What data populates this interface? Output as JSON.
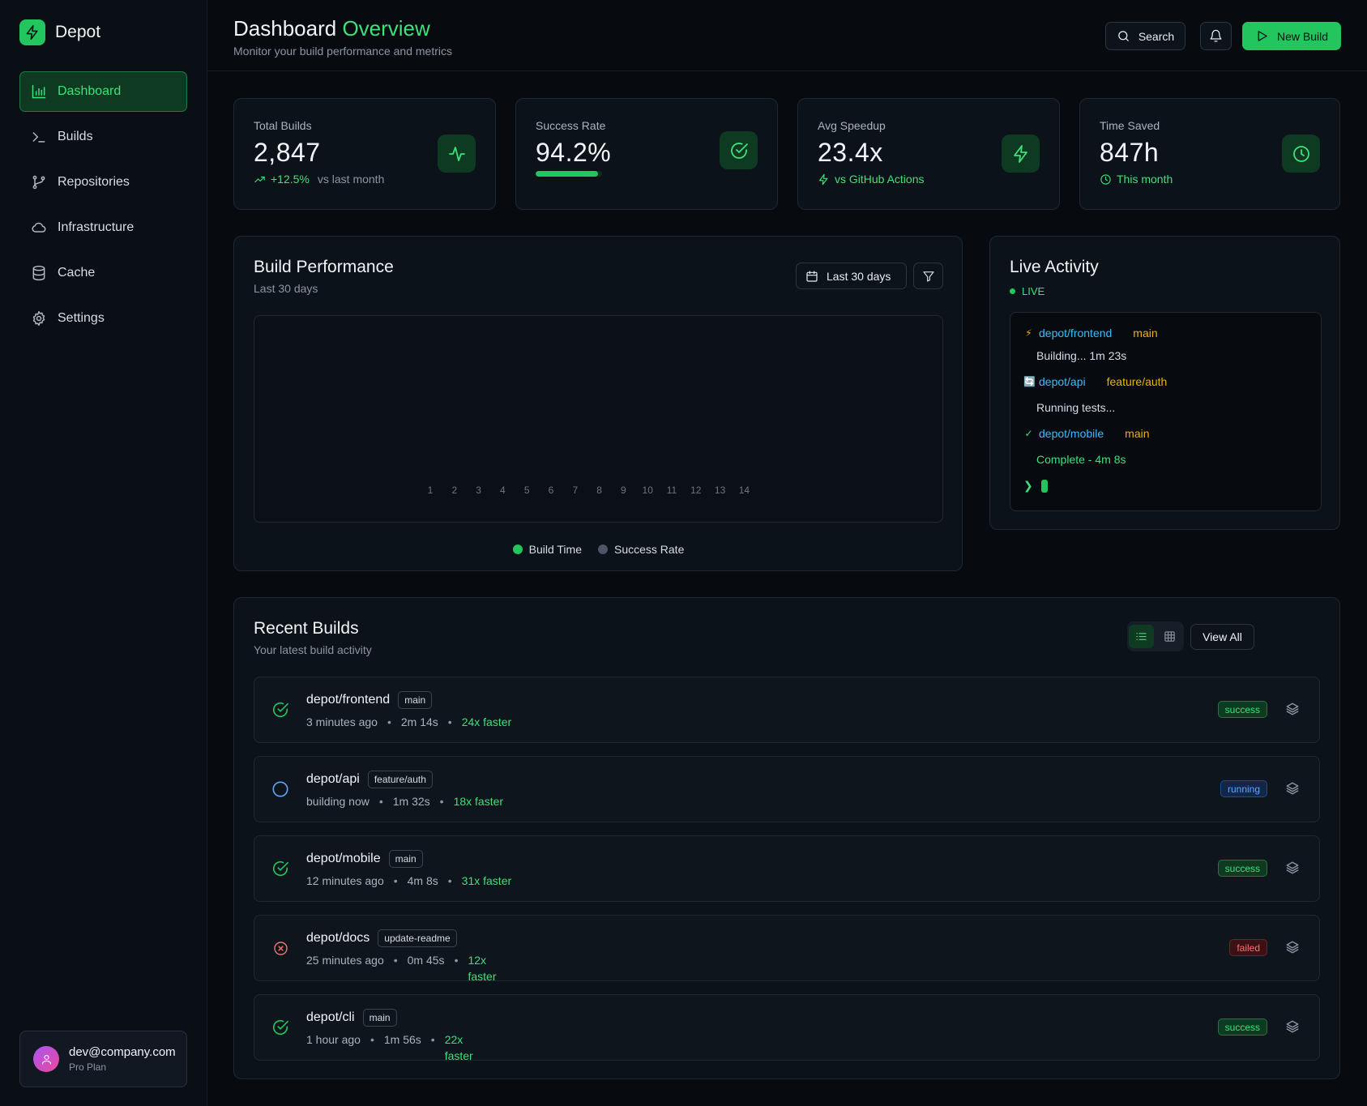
{
  "brand": {
    "name": "Depot"
  },
  "sidebar": {
    "items": [
      {
        "label": "Dashboard",
        "icon": "bar-chart-icon",
        "active": true
      },
      {
        "label": "Builds",
        "icon": "terminal-icon"
      },
      {
        "label": "Repositories",
        "icon": "git-branch-icon"
      },
      {
        "label": "Infrastructure",
        "icon": "cloud-icon"
      },
      {
        "label": "Cache",
        "icon": "database-icon"
      },
      {
        "label": "Settings",
        "icon": "gear-icon"
      }
    ],
    "user": {
      "email": "dev@company.com",
      "plan": "Pro Plan"
    }
  },
  "header": {
    "title_main": "Dashboard",
    "title_accent": "Overview",
    "subtitle": "Monitor your build performance and metrics",
    "search_label": "Search",
    "new_build_label": "New Build"
  },
  "stats": [
    {
      "label": "Total Builds",
      "value": "2,847",
      "delta": "+12.5%",
      "delta_note": "vs last month"
    },
    {
      "label": "Success Rate",
      "value": "94.2%",
      "progress": 0.942
    },
    {
      "label": "Avg Speedup",
      "value": "23.4x",
      "note": "vs GitHub Actions"
    },
    {
      "label": "Time Saved",
      "value": "847h",
      "note": "This month"
    }
  ],
  "performance": {
    "title": "Build Performance",
    "subtitle": "Last 30 days",
    "range_label": "Last 30 days",
    "x_ticks": [
      "1",
      "2",
      "3",
      "4",
      "5",
      "6",
      "7",
      "8",
      "9",
      "10",
      "11",
      "12",
      "13",
      "14"
    ],
    "legend": [
      {
        "label": "Build Time",
        "color": "#22c55e"
      },
      {
        "label": "Success Rate",
        "color": "#4b5563"
      }
    ]
  },
  "live": {
    "title": "Live Activity",
    "tag": "LIVE",
    "lines": [
      {
        "icon": "⚡",
        "repo": "depot/frontend",
        "branch": "main",
        "status": "Building... 1m 23s"
      },
      {
        "icon": "🔄",
        "repo": "depot/api",
        "branch": "feature/auth",
        "status": "Running tests..."
      },
      {
        "icon": "✓",
        "repo": "depot/mobile",
        "branch": "main",
        "status": "Complete - 4m 8s"
      }
    ],
    "prompt": "❯"
  },
  "recent": {
    "title": "Recent Builds",
    "subtitle": "Your latest build activity",
    "view_all_label": "View All",
    "builds": [
      {
        "repo": "depot/frontend",
        "branch": "main",
        "time": "3 minutes ago",
        "duration": "2m 14s",
        "speed": "24x faster",
        "status": "success"
      },
      {
        "repo": "depot/api",
        "branch": "feature/auth",
        "time": "building now",
        "duration": "1m 32s",
        "speed": "18x faster",
        "status": "running"
      },
      {
        "repo": "depot/mobile",
        "branch": "main",
        "time": "12 minutes ago",
        "duration": "4m 8s",
        "speed": "31x faster",
        "status": "success"
      },
      {
        "repo": "depot/docs",
        "branch": "update-readme",
        "time": "25 minutes ago",
        "duration": "0m 45s",
        "speed": "12x faster",
        "status": "failed"
      },
      {
        "repo": "depot/cli",
        "branch": "main",
        "time": "1 hour ago",
        "duration": "1m 56s",
        "speed": "22x faster",
        "status": "success"
      }
    ]
  },
  "colors": {
    "accent": "#22c55e",
    "running": "#60a5fa",
    "failed": "#f87171",
    "branch": "#eab308",
    "repo": "#38bdf8"
  }
}
